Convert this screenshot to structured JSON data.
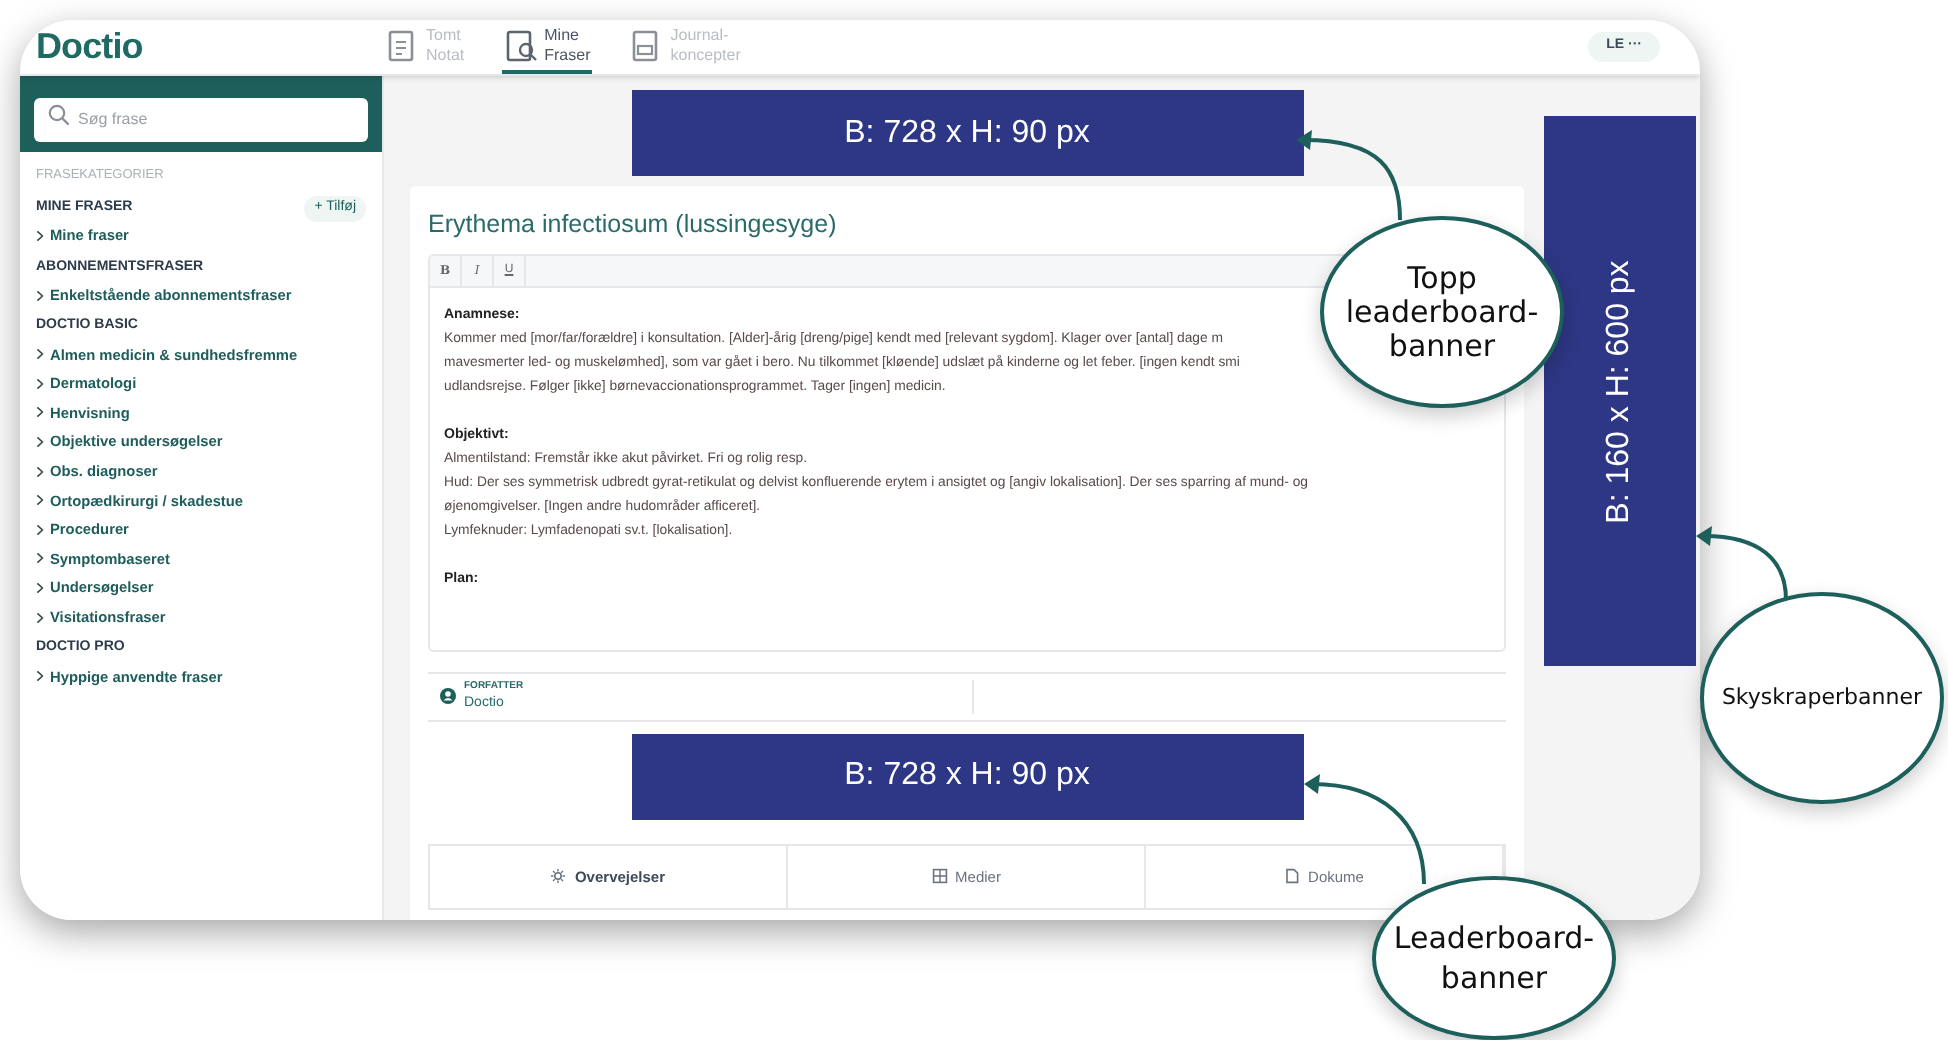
{
  "app": {
    "logo": "Doctio",
    "nav": [
      {
        "lines": [
          "Tomt",
          "Notat"
        ],
        "selected": false
      },
      {
        "lines": [
          "Mine",
          "Fraser"
        ],
        "selected": true
      },
      {
        "lines": [
          "Journal-",
          "koncepter"
        ],
        "selected": false
      }
    ],
    "user_menu": "LE ···"
  },
  "sidebar": {
    "search": {
      "placeholder": "Søg frase"
    },
    "heading": "FRASEKATEGORIER",
    "groups": [
      {
        "title": "MINE FRASER",
        "action": "+ Tilføj",
        "items": [
          "Mine fraser"
        ]
      },
      {
        "title": "ABONNEMENTSFRASER",
        "items": [
          "Enkeltstående abonnementsfraser"
        ]
      },
      {
        "title": "DOCTIO BASIC",
        "items": [
          "Almen medicin & sundhedsfremme",
          "Dermatologi",
          "Henvisning",
          "Objektive undersøgelser",
          "Obs. diagnoser",
          "Ortopædkirurgi / skadestue",
          "Procedurer",
          "Symptombaseret",
          "Undersøgelser",
          "Visitationsfraser"
        ]
      },
      {
        "title": "DOCTIO PRO",
        "items": [
          "Hyppige anvendte fraser"
        ]
      }
    ]
  },
  "phrase": {
    "title": "Erythema infectiosum (lussingesyge)",
    "toolbar": [
      "B",
      "I",
      "U"
    ],
    "sections": [
      {
        "heading": "Anamnese:",
        "lines": [
          "Kommer med [mor/far/forældre] i konsultation. [Alder]-årig [dreng/pige] kendt med [relevant sygdom]. Klager over [antal] dage m",
          "mavesmerter led- og muskelømhed], som var gået i bero. Nu tilkommet [kløende] udslæt på kinderne og let feber. [ingen kendt smi",
          "udlandsrejse. Følger [ikke] børnevaccionationsprogrammet. Tager [ingen] medicin."
        ]
      },
      {
        "heading": "Objektivt:",
        "lines": [
          "Almentilstand: Fremstår ikke akut påvirket. Fri og rolig resp.",
          "Hud: Der ses symmetrisk udbredt gyrat-retikulat og delvist konfluerende erytem i ansigtet og [angiv lokalisation]. Der ses sparring af mund- og",
          "øjenomgivelser. [Ingen andre hudområder afficeret].",
          "Lymfeknuder: Lymfadenopati sv.t. [lokalisation]."
        ]
      },
      {
        "heading": "Plan:"
      }
    ],
    "author": {
      "label": "FORFATTER",
      "value": "Doctio"
    }
  },
  "tabs": [
    {
      "label": "Overvejelser",
      "selected": true
    },
    {
      "label": "Medier",
      "selected": false
    },
    {
      "label": "Dokume",
      "selected": false
    }
  ],
  "ad_banners": [
    {
      "kind": "leaderboard",
      "label": "B: 728 x H: 90 px"
    },
    {
      "kind": "skyscraper",
      "label": "B: 160 x H: 600 px"
    },
    {
      "kind": "leaderboard",
      "label": "B: 728 x H: 90 px"
    }
  ],
  "callouts": [
    {
      "lines": [
        "Topp",
        "leaderboard-",
        "banner"
      ]
    },
    {
      "lines": [
        "Skyskraperbanner"
      ]
    },
    {
      "lines": [
        "Leaderboard-",
        "banner"
      ]
    }
  ]
}
